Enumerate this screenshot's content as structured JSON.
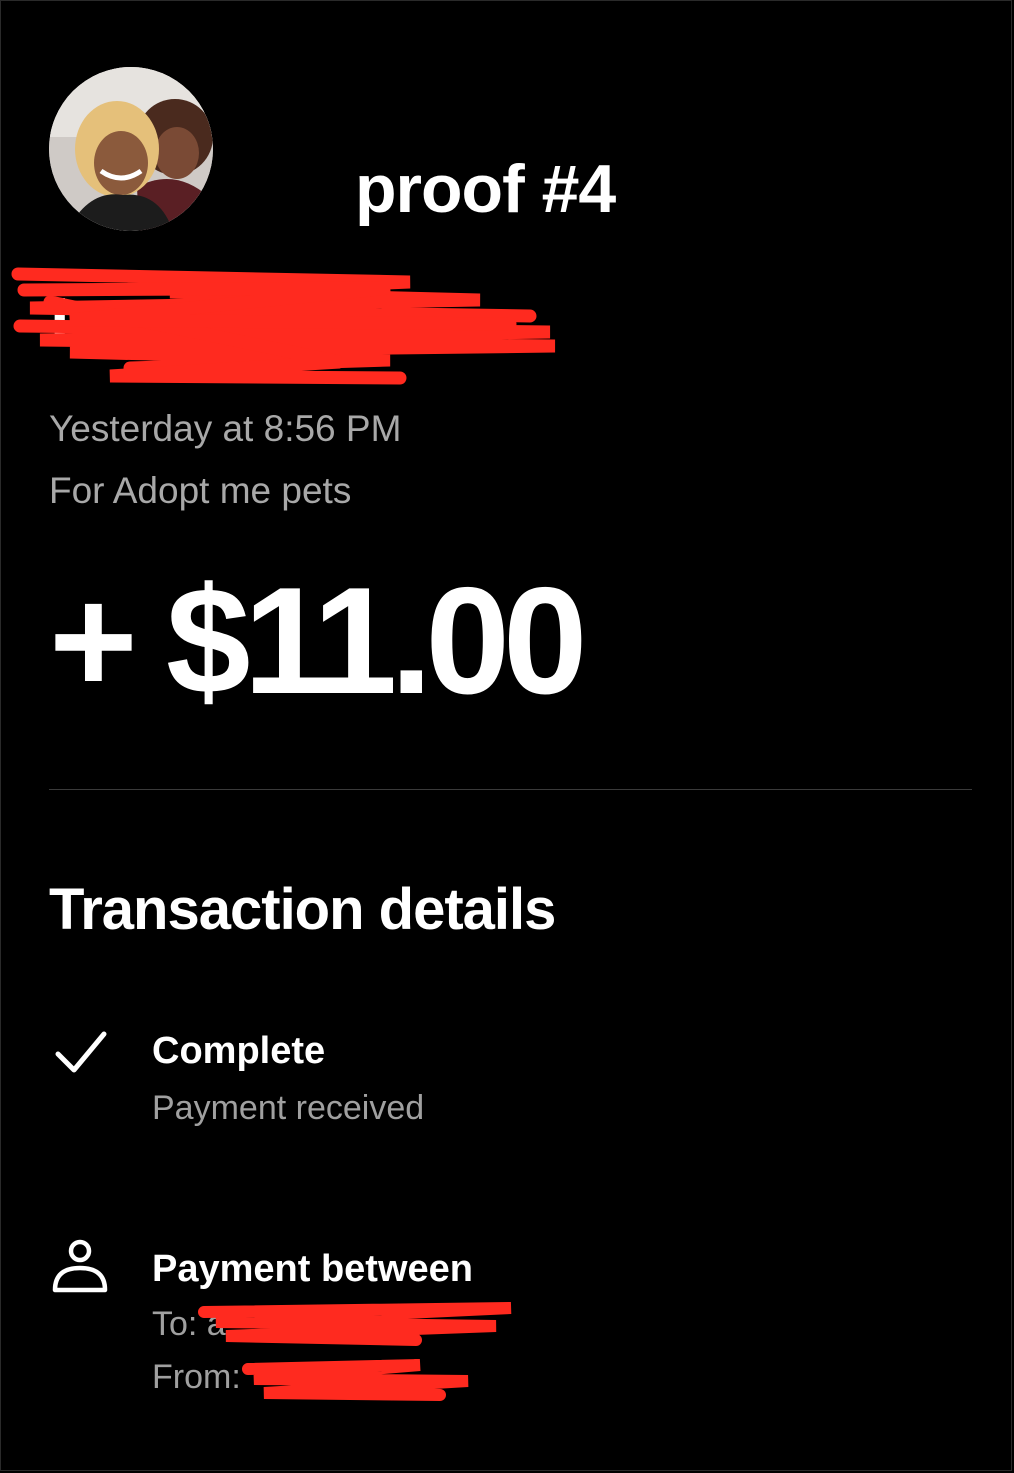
{
  "overlay": {
    "title": "proof #4"
  },
  "recipient": {
    "avatar_icon": "profile-photo",
    "name_visible_fragment": "I"
  },
  "transaction": {
    "time": "Yesterday at 8:56 PM",
    "note": "For Adopt me pets",
    "amount": "+ $11.00"
  },
  "details": {
    "section_title": "Transaction details",
    "status": {
      "icon": "check-icon",
      "title": "Complete",
      "subtitle": "Payment received"
    },
    "parties": {
      "icon": "person-icon",
      "title": "Payment between",
      "to_label": "To: a",
      "from_label": "From:"
    }
  },
  "colors": {
    "background": "#000000",
    "text_primary": "#ffffff",
    "text_secondary": "#a8a8a8",
    "redaction": "#ff2a1f"
  }
}
